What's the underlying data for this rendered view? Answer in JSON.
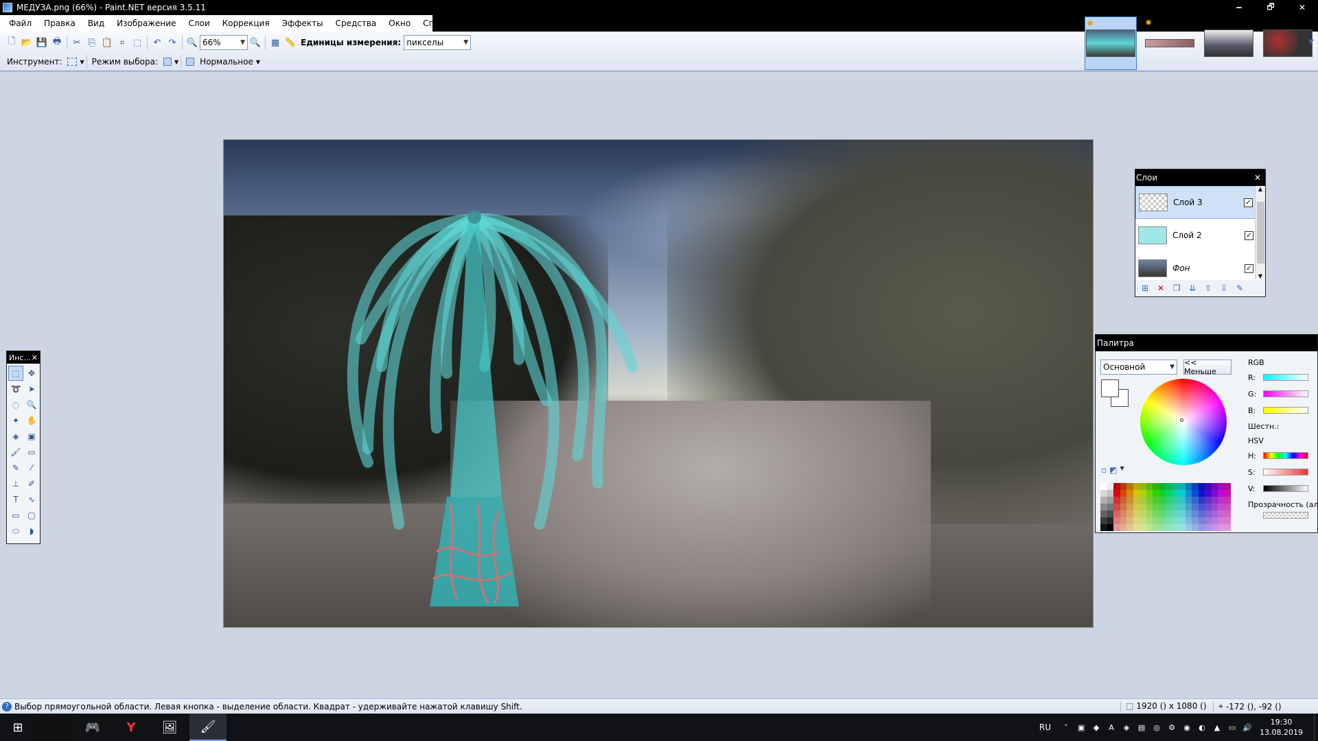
{
  "window": {
    "title": "МЕДУЗА.png (66%) - Paint.NET версия 3.5.11",
    "controls": [
      "🗕",
      "🗗",
      "✕"
    ]
  },
  "menu": [
    "Файл",
    "Правка",
    "Вид",
    "Изображение",
    "Слои",
    "Коррекция",
    "Эффекты",
    "Средства",
    "Окно",
    "Справка"
  ],
  "toolbar": {
    "zoom_value": "66%",
    "units_label": "Единицы измерения:",
    "units_value": "пикселы",
    "tool_label": "Инструмент:",
    "selection_mode_label": "Режим выбора:",
    "blend_mode": "Нормальное"
  },
  "tools_window": {
    "title": "Инс...",
    "close": "✕"
  },
  "layers_window": {
    "title": "Слои",
    "close": "✕",
    "layers": [
      {
        "name": "Слой 3",
        "visible": true,
        "selected": true
      },
      {
        "name": "Слой 2",
        "visible": true,
        "selected": false
      },
      {
        "name": "Фон",
        "visible": true,
        "selected": false
      }
    ],
    "check": "✓"
  },
  "palette_window": {
    "title": "Палитра",
    "palette_select": "Основной",
    "less_button": "<< Меньше",
    "rgb_label": "RGB",
    "r_label": "R:",
    "g_label": "G:",
    "b_label": "B:",
    "hex_label": "Шестн.:",
    "hsv_label": "HSV",
    "h_label": "H:",
    "s_label": "S:",
    "v_label": "V:",
    "alpha_label": "Прозрачность (альфа)"
  },
  "status": {
    "message": "Выбор прямоугольной области. Левая кнопка - выделение области. Квадрат - удерживайте нажатой клавишу Shift.",
    "image_size": "1920 () x 1080 ()",
    "cursor_pos": "-172 (), -92 ()"
  },
  "taskbar": {
    "lang": "RU",
    "time": "19:30",
    "date": "13.08.2019"
  },
  "colors": {
    "accent": "#3a77c9",
    "jellyfish": "#5fd6d6",
    "tentacle_root": "#c8747a"
  }
}
